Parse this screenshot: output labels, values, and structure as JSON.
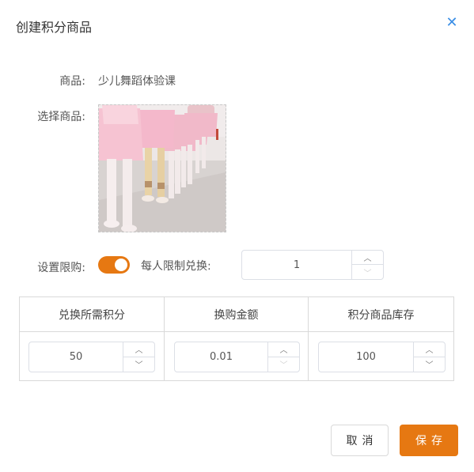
{
  "dialog": {
    "title": "创建积分商品",
    "close_icon": "close-icon"
  },
  "form": {
    "product_label": "商品:",
    "product_value": "少儿舞蹈体验课",
    "select_label": "选择商品:",
    "image_description": "ballet class children photo",
    "limit_label": "设置限购:",
    "limit_enabled": true,
    "per_person_label": "每人限制兑换:",
    "per_person_value": "1"
  },
  "table": {
    "headers": [
      "兑换所需积分",
      "换购金额",
      "积分商品库存"
    ],
    "values": [
      "50",
      "0.01",
      "100"
    ]
  },
  "footer": {
    "cancel_label": "取消",
    "save_label": "保存"
  },
  "colors": {
    "accent": "#e67812",
    "close": "#3a8ee6"
  }
}
